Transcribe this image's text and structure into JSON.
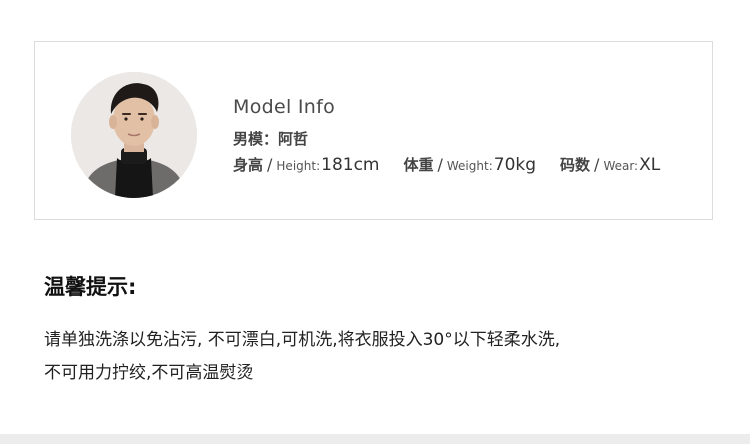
{
  "model_info": {
    "title": "Model Info",
    "name_label": "男模：",
    "name": "阿哲",
    "stats": [
      {
        "zh": "身高",
        "slash": "/",
        "en": "Height:",
        "value": "181cm"
      },
      {
        "zh": "体重",
        "slash": "/",
        "en": "Weight:",
        "value": "70kg"
      },
      {
        "zh": "码数",
        "slash": "/",
        "en": "Wear:",
        "value": "XL"
      }
    ]
  },
  "notice": {
    "title": "温馨提示:",
    "line1": "请单独洗涤以免沾污, 不可漂白,可机洗,将衣服投入30°以下轻柔水洗,",
    "line2": "不可用力拧绞,不可高温熨烫"
  },
  "colors": {
    "card_border": "#dcdcdc",
    "text_dark": "#222222",
    "footer_bar": "#ececec"
  },
  "icons": {
    "avatar": "model-portrait-photo"
  }
}
